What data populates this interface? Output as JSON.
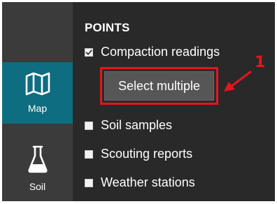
{
  "sidebar": {
    "items": [
      {
        "label": "Map",
        "icon": "map-icon",
        "active": true
      },
      {
        "label": "Soil",
        "icon": "flask-icon",
        "active": false
      }
    ]
  },
  "panel": {
    "section_title": "POINTS",
    "layers": [
      {
        "label": "Compaction readings",
        "checked": true
      },
      {
        "label": "Soil samples",
        "checked": false
      },
      {
        "label": "Scouting reports",
        "checked": false
      },
      {
        "label": "Weather stations",
        "checked": false
      }
    ],
    "select_multiple_label": "Select multiple"
  },
  "annotation": {
    "callout_number": "1",
    "color": "#e8141b"
  },
  "colors": {
    "sidebar_active": "#0e6d80",
    "background": "#292929",
    "sidebar": "#3b3b3b"
  }
}
